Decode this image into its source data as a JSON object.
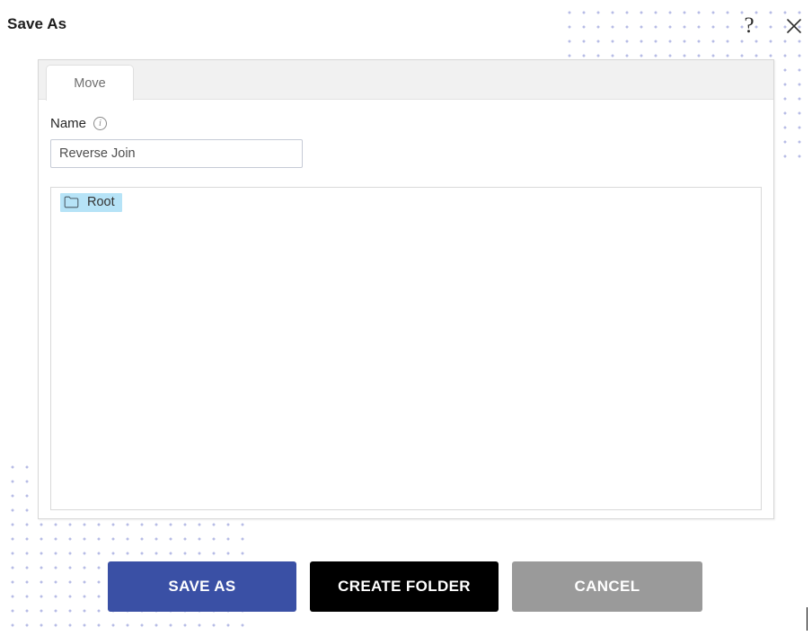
{
  "window": {
    "title": "Save As",
    "help_icon": "question-mark-icon",
    "help_label": "?",
    "close_icon": "close-x-icon"
  },
  "dialog": {
    "tabs": [
      {
        "label": "Move",
        "active": true
      }
    ],
    "name_field": {
      "label": "Name",
      "info_icon": "info-circle-icon",
      "info_glyph": "i",
      "value": "Reverse Join",
      "placeholder": "Name"
    },
    "tree": {
      "nodes": [
        {
          "label": "Root",
          "icon": "folder-icon",
          "selected": true
        }
      ]
    }
  },
  "footer": {
    "buttons": [
      {
        "label": "SAVE AS",
        "color": "#3a50a5"
      },
      {
        "label": "CREATE FOLDER",
        "color": "#000000"
      },
      {
        "label": "CANCEL",
        "color": "#9a9a9a"
      }
    ]
  },
  "decor": {
    "dot_color": "#8b93d6"
  }
}
